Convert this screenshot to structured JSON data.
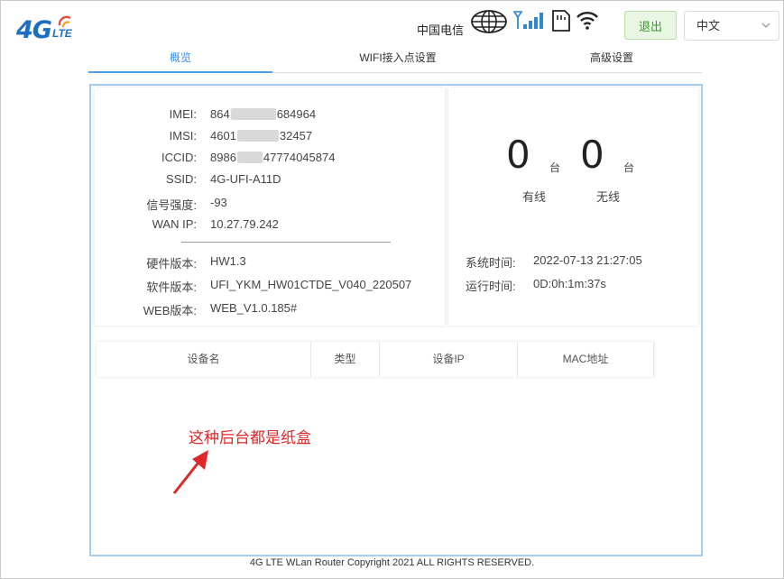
{
  "header": {
    "logo": {
      "main": "4G",
      "sub": "LTE"
    },
    "carrier": "中国电信",
    "logout_label": "退出",
    "language": "中文",
    "icons": [
      "globe-icon",
      "signal-icon",
      "sim-card-icon",
      "wifi-icon"
    ]
  },
  "tabs": [
    {
      "label": "概览",
      "active": true
    },
    {
      "label": "WIFI接入点设置",
      "active": false
    },
    {
      "label": "高级设置",
      "active": false
    }
  ],
  "device_info": {
    "imei": {
      "label": "IMEI:",
      "pre": "864",
      "post": "684964"
    },
    "imsi": {
      "label": "IMSI:",
      "pre": "4601",
      "post": "32457"
    },
    "iccid": {
      "label": "ICCID:",
      "pre": "8986",
      "post": "47774045874"
    },
    "ssid": {
      "label": "SSID:",
      "value": "4G-UFI-A11D"
    },
    "signal": {
      "label": "信号强度:",
      "value": "-93"
    },
    "wan_ip": {
      "label": "WAN IP:",
      "value": "10.27.79.242"
    },
    "hardware": {
      "label": "硬件版本:",
      "value": "HW1.3"
    },
    "software": {
      "label": "软件版本:",
      "value": "UFI_YKM_HW01CTDE_V040_220507"
    },
    "web": {
      "label": "WEB版本:",
      "value": "WEB_V1.0.185#"
    }
  },
  "clients": {
    "wired_count": "0",
    "wireless_count": "0",
    "unit": "台",
    "wired_label": "有线",
    "wireless_label": "无线"
  },
  "system": {
    "time_label": "系统时间:",
    "time_value": "2022-07-13 21:27:05",
    "uptime_label": "运行时间:",
    "uptime_value": "0D:0h:1m:37s"
  },
  "device_table": {
    "columns": [
      "设备名",
      "类型",
      "设备IP",
      "MAC地址"
    ],
    "rows": []
  },
  "annotation": "这种后台都是纸盒",
  "footer": "4G LTE WLan Router Copyright 2021 ALL RIGHTS RESERVED.",
  "colors": {
    "accent": "#4aa1f0",
    "logo": "#1e6fc4",
    "annotation": "#e02727",
    "logout_bg": "#e9f6e4"
  }
}
